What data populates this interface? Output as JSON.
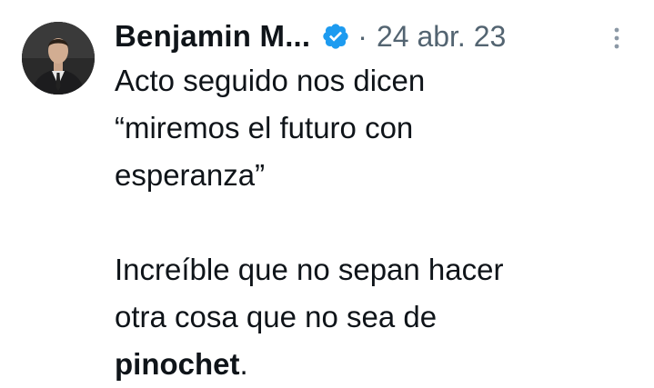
{
  "tweet": {
    "author": {
      "display_name": "Benjamin M...",
      "verified": true,
      "verified_icon": "verified-badge-icon"
    },
    "separator": "·",
    "date": "24 abr. 23",
    "more_icon": "more-vertical-icon",
    "colors": {
      "text": "#0f1419",
      "secondary": "#536471",
      "verified": "#1d9bf0"
    },
    "body": {
      "line1": "Acto seguido nos dicen",
      "line2": "“miremos el futuro con",
      "line3": "esperanza”",
      "line4": "Increíble que no sepan hacer",
      "line5": "otra cosa que no sea de",
      "line6_bold": "pinochet",
      "line6_rest": "."
    }
  }
}
